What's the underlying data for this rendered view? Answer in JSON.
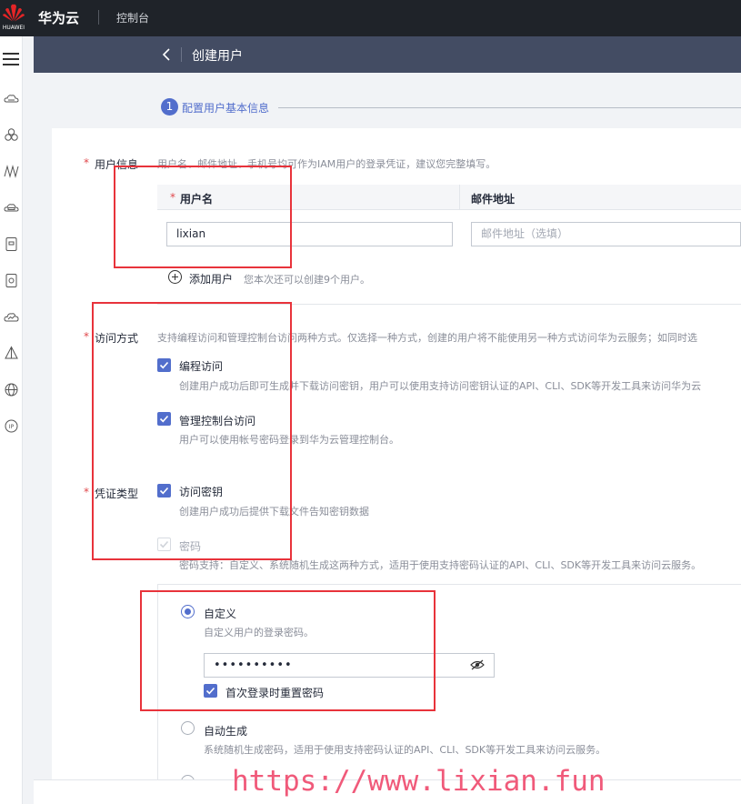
{
  "topbar": {
    "logo_text": "HUAWEI",
    "brand": "华为云",
    "console": "控制台"
  },
  "sidebar": {
    "icons": [
      "cloud-server-icon",
      "cluster-icon",
      "network-wave-icon",
      "storage-icon",
      "database-icon",
      "security-icon",
      "monitor-cloud-icon",
      "deploy-icon",
      "global-network-icon",
      "ip-icon"
    ]
  },
  "header": {
    "title": "创建用户"
  },
  "step": {
    "number": "1",
    "label": "配置用户基本信息"
  },
  "user_info": {
    "required_mark": "*",
    "label": "用户信息",
    "hint": "用户名、邮件地址、手机号均可作为IAM用户的登录凭证，建议您完整填写。",
    "col_username": "用户名",
    "col_email": "邮件地址",
    "username_value": "lixian",
    "email_placeholder": "邮件地址（选填）",
    "add_user_label": "添加用户",
    "add_user_hint": "您本次还可以创建9个用户。"
  },
  "access": {
    "required_mark": "*",
    "label": "访问方式",
    "hint": "支持编程访问和管理控制台访问两种方式。仅选择一种方式，创建的用户将不能使用另一种方式访问华为云服务；如同时选",
    "programmatic_label": "编程访问",
    "programmatic_desc": "创建用户成功后即可生成并下载访问密钥，用户可以使用支持访问密钥认证的API、CLI、SDK等开发工具来访问华为云",
    "console_label": "管理控制台访问",
    "console_desc": "用户可以使用帐号密码登录到华为云管理控制台。"
  },
  "credential": {
    "required_mark": "*",
    "label": "凭证类型",
    "access_key_label": "访问密钥",
    "access_key_desc": "创建用户成功后提供下载文件告知密钥数据",
    "password_label": "密码",
    "password_desc": "密码支持：自定义、系统随机生成这两种方式，适用于使用支持密码认证的API、CLI、SDK等开发工具来访问云服务。",
    "custom_label": "自定义",
    "custom_desc": "自定义用户的登录密码。",
    "password_value": "••••••••••",
    "reset_label": "首次登录时重置密码",
    "auto_label": "自动生成",
    "auto_desc": "系统随机生成密码，适用于使用支持密码认证的API、CLI、SDK等开发工具来访问云服务。"
  },
  "watermark": "https://www.lixian.fun",
  "colors": {
    "accent": "#526ecc",
    "annotation_red": "#e8333b",
    "header_bg": "#434c63",
    "topbar_bg": "#1f2329"
  }
}
